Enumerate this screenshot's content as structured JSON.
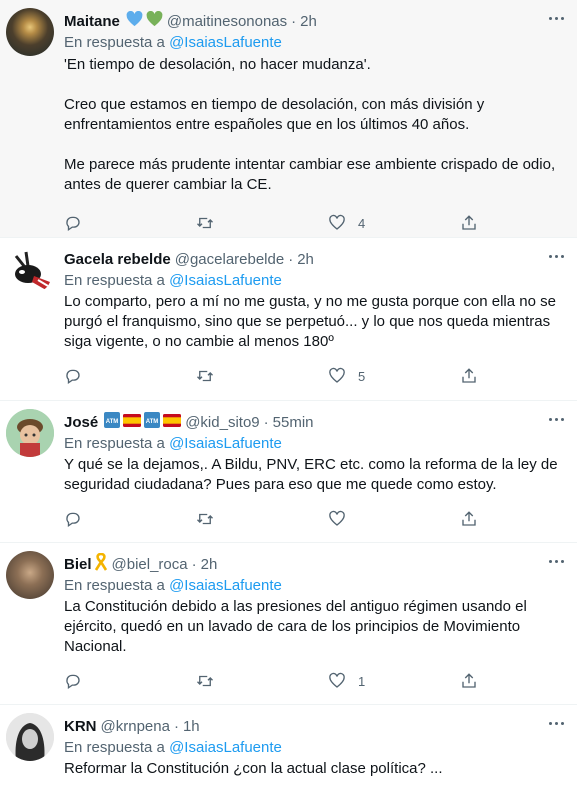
{
  "reply_prefix": "En respuesta a",
  "tweets": [
    {
      "name": "Maitane",
      "emoji": [
        "blue-heart",
        "green-heart"
      ],
      "handle": "@maitinesononas",
      "time": "2h",
      "reply_to": "@IsaiasLafuente",
      "text": "'En tiempo de desolación, no hacer mudanza'.\n\nCreo que estamos en tiempo de desolación, con más división y enfrentamientos entre españoles que en los últimos 40 años.\n\nMe parece más prudente intentar cambiar ese ambiente crispado de odio, antes de querer cambiar la CE.",
      "likes": "4",
      "avatar_color": "#6b5b3e"
    },
    {
      "name": "Gacela rebelde",
      "emoji": [],
      "handle": "@gacelarebelde",
      "time": "2h",
      "reply_to": "@IsaiasLafuente",
      "text": "Lo comparto, pero a mí no me gusta, y no me gusta porque con ella no se purgó el franquismo, sino que se perpetuó... y lo que nos queda mientras siga vigente, o no cambie al menos 180º",
      "likes": "5",
      "avatar_color": "#ffffff"
    },
    {
      "name": "José",
      "emoji": [
        "atm",
        "spain-flag",
        "atm",
        "spain-flag"
      ],
      "handle": "@kid_sito9",
      "time": "55min",
      "reply_to": "@IsaiasLafuente",
      "text": "Y qué se la dejamos,. A Bildu, PNV, ERC etc. como la reforma de la ley de seguridad ciudadana? Pues para eso que me quede como estoy.",
      "likes": "",
      "avatar_color": "#9fc6a5"
    },
    {
      "name": "Biel",
      "emoji": [
        "yellow-ribbon"
      ],
      "handle": "@biel_roca",
      "time": "2h",
      "reply_to": "@IsaiasLafuente",
      "text": "La Constitución debido a las presiones del antiguo régimen usando el ejército, quedó en un lavado de cara de los principios de Movimiento Nacional.",
      "likes": "1",
      "avatar_color": "#7a6a58"
    },
    {
      "name": "KRN",
      "emoji": [],
      "handle": "@krnpena",
      "time": "1h",
      "reply_to": "@IsaiasLafuente",
      "text": "Reformar la  Constitución ¿con la actual  clase política? ...",
      "likes": "",
      "avatar_color": "#d8d8d8"
    }
  ]
}
